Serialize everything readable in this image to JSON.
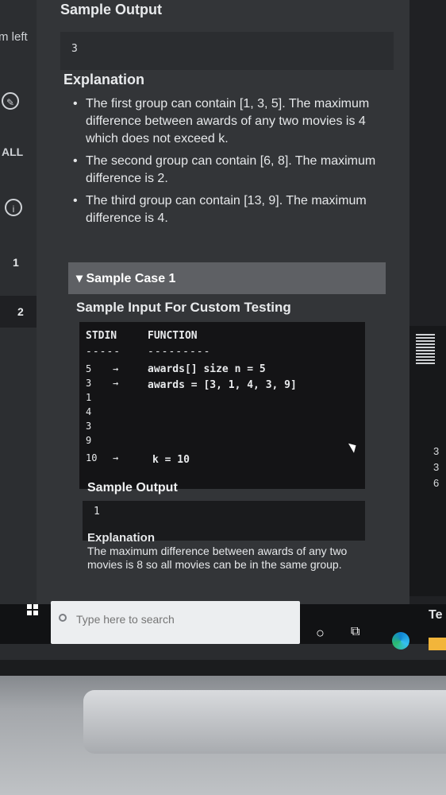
{
  "left_nav": {
    "time_left_label": "m left",
    "all_label": "ALL",
    "question_numbers": [
      "1",
      "2"
    ]
  },
  "top": {
    "sample_output_heading": "Sample Output",
    "sample_output_value": "3",
    "explanation_heading": "Explanation",
    "bullets": [
      "The first group can contain [1, 3, 5]. The maximum difference between awards of any two movies is 4 which does not exceed k.",
      "The second group can contain [6, 8]. The maximum difference is 2.",
      "The third group can contain [13, 9]. The maximum difference is 4."
    ]
  },
  "sample_case": {
    "title": "Sample Case 1",
    "custom_input_heading": "Sample Input For Custom Testing",
    "stdin_header": "STDIN",
    "function_header": "FUNCTION",
    "stdin_dashes": "-----",
    "function_dashes": "---------",
    "stdin_lines": [
      "5",
      "3",
      "1",
      "4",
      "3",
      "9",
      "10"
    ],
    "arrow": "→",
    "function_lines": [
      "awards[] size n = 5",
      "awards = [3, 1, 4, 3, 9]",
      "k = 10"
    ],
    "sample_output_heading": "Sample Output",
    "sample_output_value": "1",
    "explanation_heading": "Explanation",
    "explanation_text": "The maximum difference between awards of any two movies is 8 so all movies can be in the same group."
  },
  "right_panel": {
    "fragments": [
      "3",
      "3",
      "6"
    ],
    "te_label": "Te"
  },
  "taskbar": {
    "search_placeholder": "Type here to search"
  }
}
